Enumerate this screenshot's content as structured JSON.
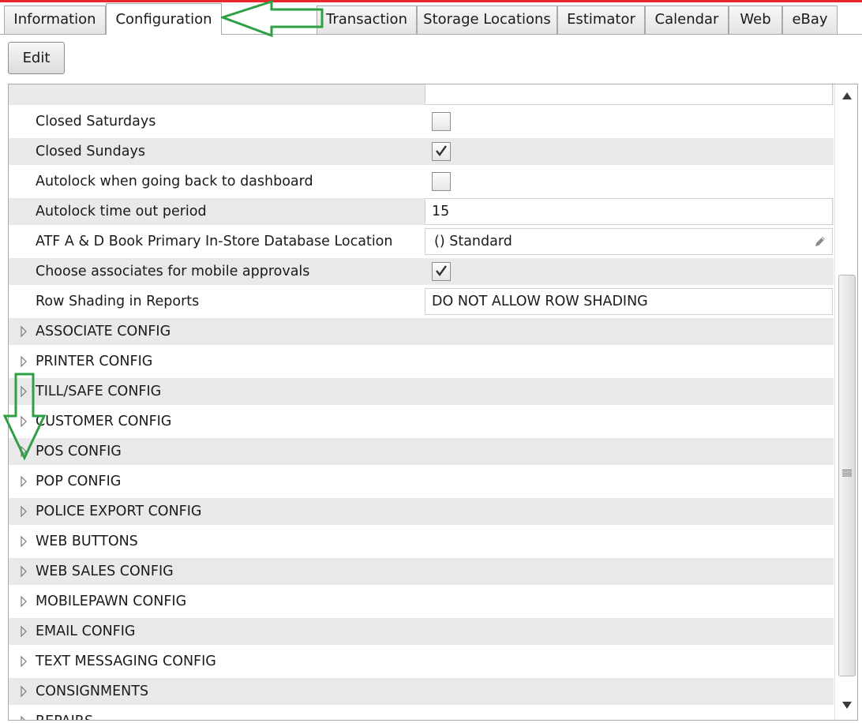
{
  "tabs": [
    {
      "label": "Information"
    },
    {
      "label": "Configuration"
    },
    {
      "label": "Transaction"
    },
    {
      "label": "Storage Locations"
    },
    {
      "label": "Estimator"
    },
    {
      "label": "Calendar"
    },
    {
      "label": "Web"
    },
    {
      "label": "eBay"
    }
  ],
  "toolbar": {
    "edit_label": "Edit"
  },
  "settings": {
    "closed_saturdays": {
      "label": "Closed Saturdays",
      "checked": false
    },
    "closed_sundays": {
      "label": "Closed Sundays",
      "checked": true
    },
    "autolock_dashboard": {
      "label": "Autolock when going back to dashboard",
      "checked": false
    },
    "autolock_timeout": {
      "label": "Autolock time out period",
      "value": "15"
    },
    "atf_location": {
      "label": "ATF A & D Book Primary In-Store Database Location",
      "value": "() Standard"
    },
    "mobile_approvals": {
      "label": "Choose associates for mobile approvals",
      "checked": true
    },
    "row_shading": {
      "label": "Row Shading in Reports",
      "value": "DO NOT ALLOW ROW SHADING"
    }
  },
  "sections": [
    {
      "label": "ASSOCIATE CONFIG"
    },
    {
      "label": "PRINTER CONFIG"
    },
    {
      "label": "TILL/SAFE CONFIG"
    },
    {
      "label": "CUSTOMER CONFIG"
    },
    {
      "label": "POS CONFIG"
    },
    {
      "label": "POP CONFIG"
    },
    {
      "label": "POLICE EXPORT CONFIG"
    },
    {
      "label": "WEB BUTTONS"
    },
    {
      "label": "WEB SALES CONFIG"
    },
    {
      "label": "MOBILEPAWN CONFIG"
    },
    {
      "label": "EMAIL CONFIG"
    },
    {
      "label": "TEXT MESSAGING CONFIG"
    },
    {
      "label": "CONSIGNMENTS"
    },
    {
      "label": "REPAIRS"
    }
  ],
  "colors": {
    "accent_red": "#e8262b",
    "annotation_green": "#2ea043",
    "row_shade": "#e9e9e9"
  }
}
